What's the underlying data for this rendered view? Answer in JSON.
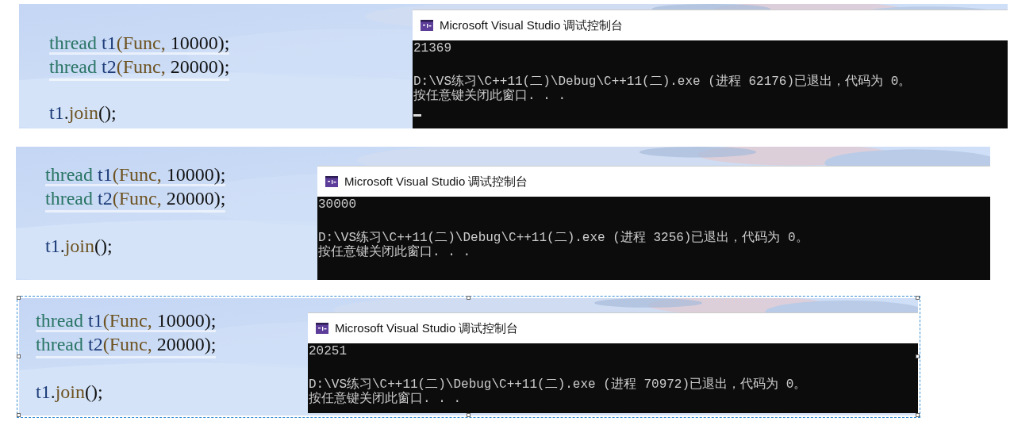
{
  "panels": [
    {
      "selected": false,
      "code_lines": [
        {
          "highlighted": false,
          "tokens": [
            {
              "kind": "type",
              "text": "thread"
            },
            {
              "kind": "var",
              "text": " t1"
            },
            {
              "kind": "call",
              "text": "(Func, "
            },
            {
              "kind": "plain",
              "text": "10000);"
            }
          ]
        },
        {
          "highlighted": true,
          "tokens": [
            {
              "kind": "type",
              "text": "thread"
            },
            {
              "kind": "var",
              "text": " t2"
            },
            {
              "kind": "call",
              "text": "(Func, "
            },
            {
              "kind": "plain",
              "text": "20000);"
            }
          ]
        },
        {
          "highlighted": false,
          "tokens": [
            {
              "kind": "var",
              "text": "t1"
            },
            {
              "kind": "plain",
              "text": "."
            },
            {
              "kind": "call",
              "text": "join"
            },
            {
              "kind": "plain",
              "text": "();"
            }
          ]
        }
      ],
      "console": {
        "title": "Microsoft Visual Studio 调试控制台",
        "result": "21369",
        "exit_message": "D:\\VS练习\\C++11(二)\\Debug\\C++11(二).exe (进程 62176)已退出，代码为 0。",
        "prompt": "按任意键关闭此窗口. . .",
        "cursor": true
      }
    },
    {
      "selected": false,
      "code_lines": [
        {
          "highlighted": false,
          "tokens": [
            {
              "kind": "type",
              "text": "thread"
            },
            {
              "kind": "var",
              "text": " t1"
            },
            {
              "kind": "call",
              "text": "(Func, "
            },
            {
              "kind": "plain",
              "text": "10000);"
            }
          ]
        },
        {
          "highlighted": true,
          "tokens": [
            {
              "kind": "type",
              "text": "thread"
            },
            {
              "kind": "var",
              "text": " t2"
            },
            {
              "kind": "call",
              "text": "(Func, "
            },
            {
              "kind": "plain",
              "text": "20000);"
            }
          ]
        },
        {
          "highlighted": false,
          "tokens": [
            {
              "kind": "var",
              "text": "t1"
            },
            {
              "kind": "plain",
              "text": "."
            },
            {
              "kind": "call",
              "text": "join"
            },
            {
              "kind": "plain",
              "text": "();"
            }
          ]
        }
      ],
      "console": {
        "title": "Microsoft Visual Studio 调试控制台",
        "result": "30000",
        "exit_message": "D:\\VS练习\\C++11(二)\\Debug\\C++11(二).exe (进程 3256)已退出，代码为 0。",
        "prompt": "按任意键关闭此窗口. . .",
        "cursor": false
      }
    },
    {
      "selected": true,
      "code_lines": [
        {
          "highlighted": false,
          "tokens": [
            {
              "kind": "type",
              "text": "thread"
            },
            {
              "kind": "var",
              "text": " t1"
            },
            {
              "kind": "call",
              "text": "(Func, "
            },
            {
              "kind": "plain",
              "text": "10000);"
            }
          ]
        },
        {
          "highlighted": true,
          "tokens": [
            {
              "kind": "type",
              "text": "thread"
            },
            {
              "kind": "var",
              "text": " t2"
            },
            {
              "kind": "call",
              "text": "(Func, "
            },
            {
              "kind": "plain",
              "text": "20000);"
            }
          ]
        },
        {
          "highlighted": false,
          "tokens": [
            {
              "kind": "var",
              "text": "t1"
            },
            {
              "kind": "plain",
              "text": "."
            },
            {
              "kind": "call",
              "text": "join"
            },
            {
              "kind": "plain",
              "text": "();"
            }
          ]
        }
      ],
      "console": {
        "title": "Microsoft Visual Studio 调试控制台",
        "result": "20251",
        "exit_message": "D:\\VS练习\\C++11(二)\\Debug\\C++11(二).exe (进程 70972)已退出，代码为 0。",
        "prompt": "按任意键关闭此窗口. . .",
        "cursor": false
      }
    }
  ]
}
